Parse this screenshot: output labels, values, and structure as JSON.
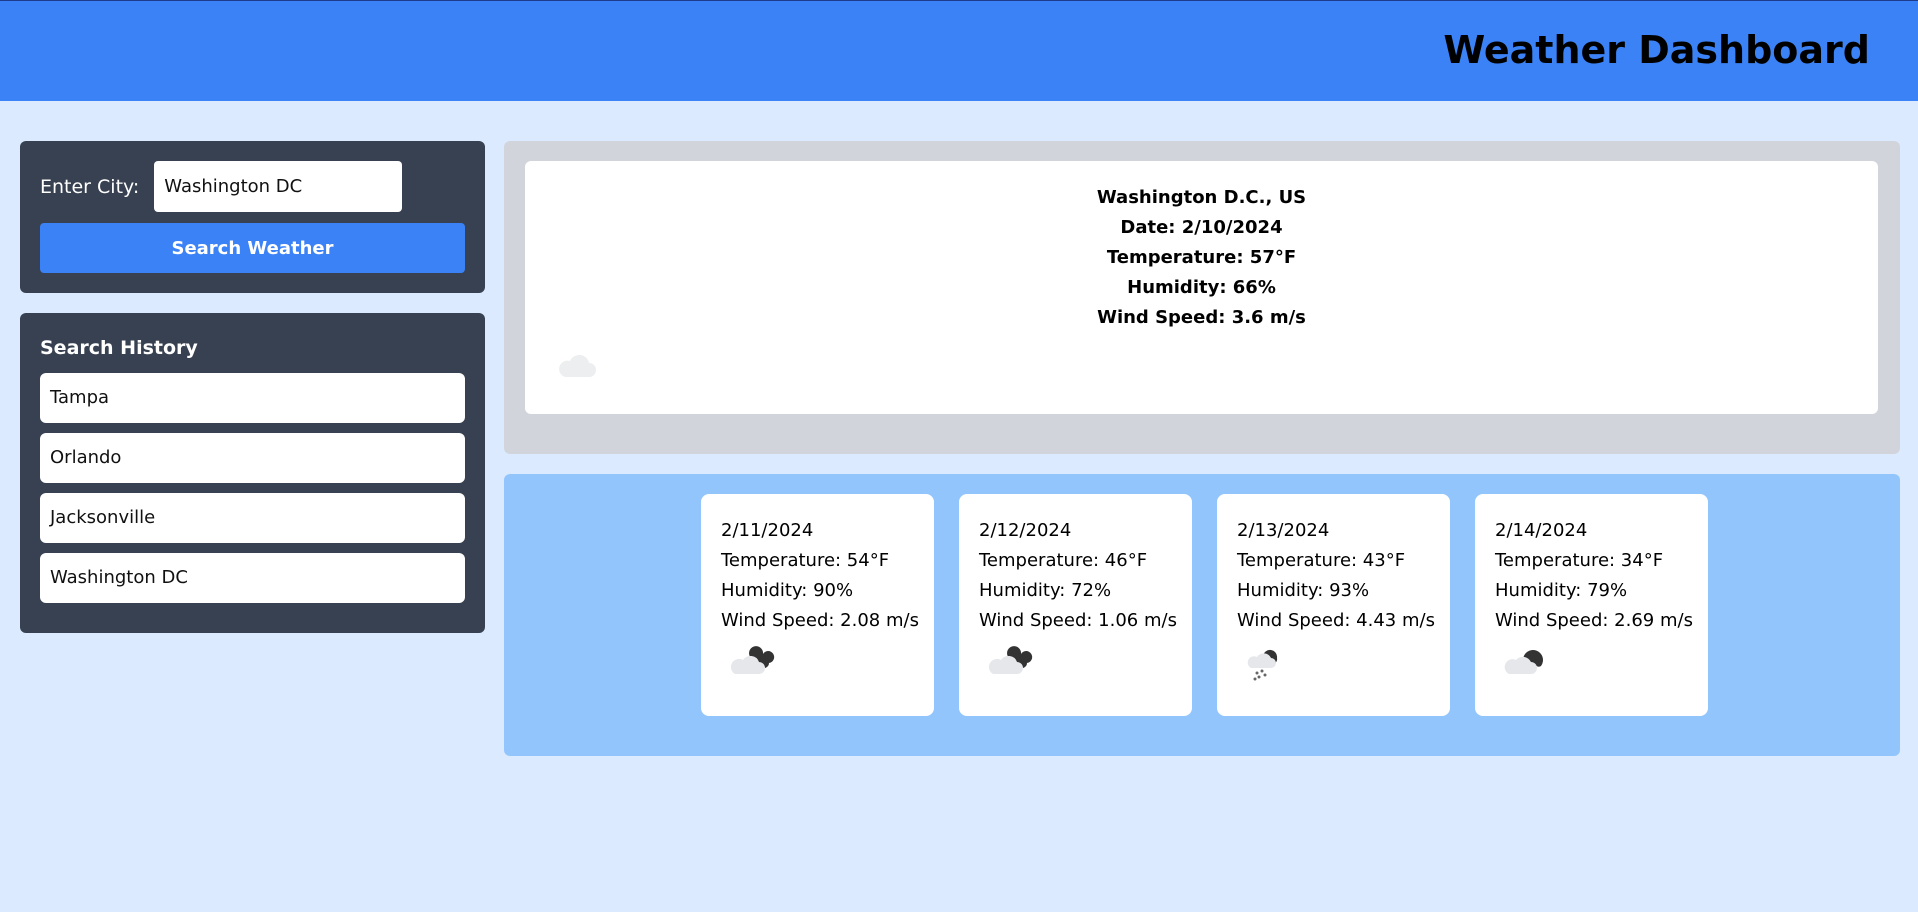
{
  "header": {
    "title": "Weather Dashboard"
  },
  "search": {
    "label": "Enter City:",
    "input_value": "Washington DC",
    "button_label": "Search Weather"
  },
  "history": {
    "title": "Search History",
    "items": [
      {
        "label": "Tampa"
      },
      {
        "label": "Orlando"
      },
      {
        "label": "Jacksonville"
      },
      {
        "label": "Washington DC"
      }
    ]
  },
  "current": {
    "location": "Washington D.C., US",
    "date": "Date: 2/10/2024",
    "temperature": "Temperature: 57°F",
    "humidity": "Humidity: 66%",
    "wind": "Wind Speed: 3.6 m/s",
    "icon": "cloud-icon"
  },
  "forecast": [
    {
      "date": "2/11/2024",
      "temperature": "Temperature: 54°F",
      "humidity": "Humidity: 90%",
      "wind": "Wind Speed: 2.08 m/s",
      "icon": "broken-clouds-icon"
    },
    {
      "date": "2/12/2024",
      "temperature": "Temperature: 46°F",
      "humidity": "Humidity: 72%",
      "wind": "Wind Speed: 1.06 m/s",
      "icon": "broken-clouds-icon"
    },
    {
      "date": "2/13/2024",
      "temperature": "Temperature: 43°F",
      "humidity": "Humidity: 93%",
      "wind": "Wind Speed: 4.43 m/s",
      "icon": "snow-icon"
    },
    {
      "date": "2/14/2024",
      "temperature": "Temperature: 34°F",
      "humidity": "Humidity: 79%",
      "wind": "Wind Speed: 2.69 m/s",
      "icon": "overcast-clouds-icon"
    }
  ],
  "colors": {
    "header": "#3b82f6",
    "page_background": "#dbeafe",
    "panel": "#374151",
    "button": "#3b82f6",
    "current_wrap": "#d1d5db",
    "forecast_wrap": "#93c5fd"
  }
}
